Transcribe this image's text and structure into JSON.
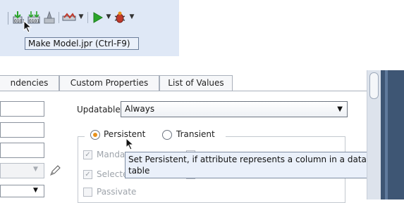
{
  "toolbar": {
    "tooltip": "Make Model.jpr (Ctrl-F9)",
    "icons": [
      "make-icon",
      "rebuild-icon",
      "clean-icon",
      "deploy-icon",
      "run-icon",
      "debug-icon"
    ],
    "colors": {
      "run": "#2aa52a",
      "debug": "#c0392b",
      "panel": "#dfe8f6"
    }
  },
  "tabs": [
    "ndencies",
    "Custom Properties",
    "List of Values"
  ],
  "updatable": {
    "label": "Updatable:",
    "value": "Always"
  },
  "persistence": {
    "persistent_label": "Persistent",
    "transient_label": "Transient",
    "selected": "Persistent"
  },
  "checkboxes": [
    {
      "label": "Manda",
      "checked": true
    },
    {
      "label": "Selecte",
      "checked": true
    },
    {
      "label": "Passivate",
      "checked": false
    }
  ],
  "tooltip_persist": "Set Persistent, if attribute represents a column in a database table"
}
